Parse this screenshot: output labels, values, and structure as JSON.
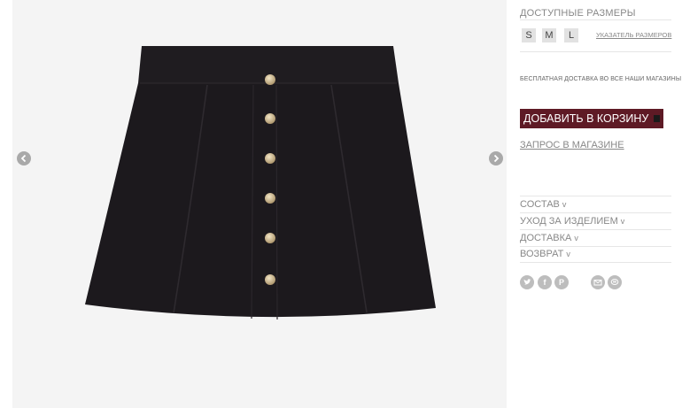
{
  "product": {
    "image_alt": "skirt-image",
    "color": "#1e1b1f",
    "button_color": "#c9b48a"
  },
  "gallery": {
    "prev_icon": "chevron-left-icon",
    "next_icon": "chevron-right-icon"
  },
  "sizes": {
    "title": "ДОСТУПНЫЕ РАЗМЕРЫ",
    "options": [
      "S",
      "M",
      "L"
    ],
    "guide_label": "УКАЗАТЕЛЬ РАЗМЕРОВ"
  },
  "shipping": {
    "free_text": "БЕСПЛАТНАЯ ДОСТАВКА ВО ВСЕ НАШИ МАГАЗИНЫ"
  },
  "actions": {
    "add_to_cart": "ДОБАВИТЬ В КОРЗИНУ",
    "add_to_cart_color": "#5e1a25",
    "store_request": "ЗАПРОС В МАГАЗИНЕ"
  },
  "accordion": [
    {
      "label": "СОСТАВ",
      "chevron": "v"
    },
    {
      "label": "УХОД ЗА ИЗДЕЛИЕМ",
      "chevron": "v"
    },
    {
      "label": "ДОСТАВКА",
      "chevron": "v"
    },
    {
      "label": "ВОЗВРАТ",
      "chevron": "v"
    }
  ],
  "share": {
    "icons": [
      "twitter-icon",
      "facebook-icon",
      "pinterest-icon",
      "email-icon",
      "chat-icon"
    ]
  }
}
